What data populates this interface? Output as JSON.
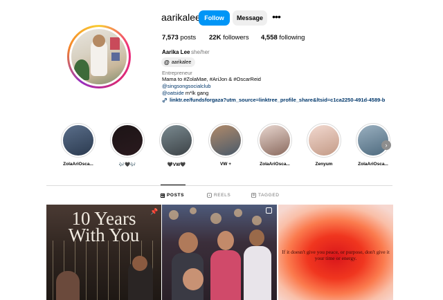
{
  "profile": {
    "username": "aarikalee",
    "follow_label": "Follow",
    "message_label": "Message",
    "more_label": "•••",
    "stats": {
      "posts_count": "7,573",
      "posts_label": "posts",
      "followers_count": "22K",
      "followers_label": "followers",
      "following_count": "4,558",
      "following_label": "following"
    },
    "name": "Aarika Lee",
    "pronouns": "she/her",
    "threads_handle": "aarikalee",
    "category": "Entrepreneur",
    "bio": {
      "line1": "Mama to #ZolaMae, #AriJon & #OscarReid",
      "line2": "@singsongsocialclub",
      "line3_mention": "@oatside",
      "line3_rest": " m*lk gang",
      "link": "linktr.ee/fundsforgaza?utm_source=linktree_profile_share&ltsid=c1ca2250-491d-4589-b"
    }
  },
  "highlights": [
    {
      "label": "ZolaAriOsca...",
      "colors": [
        "#5a6e8a",
        "#2b3a4f"
      ]
    },
    {
      "label": "🎶🖤🎶",
      "colors": [
        "#1c1416",
        "#2a1a1e"
      ]
    },
    {
      "label": "🖤VW🖤",
      "colors": [
        "#7a8a90",
        "#3c4246"
      ]
    },
    {
      "label": "VW +",
      "colors": [
        "#b08a6a",
        "#4a5a6a"
      ]
    },
    {
      "label": "ZolaAriOsca...",
      "colors": [
        "#e8d6cf",
        "#8a6a5e"
      ]
    },
    {
      "label": "Zenyum",
      "colors": [
        "#f2d9d0",
        "#c39a86"
      ]
    },
    {
      "label": "ZolaAriOsca...",
      "colors": [
        "#9ab0c0",
        "#4e6a7e"
      ]
    }
  ],
  "tabs": {
    "posts": "POSTS",
    "reels": "REELS",
    "tagged": "TAGGED"
  },
  "posts": [
    {
      "title_line1": "10 Years",
      "title_line2": "With You"
    },
    {},
    {
      "text": "If it doesn't give you peace, or purpose, don't give it your time or energy."
    }
  ],
  "icons": {
    "more": "more-horizontal-icon",
    "threads": "threads-icon",
    "link": "link-icon",
    "next": "chevron-right-icon",
    "posts_tab": "grid-icon",
    "reels_tab": "reels-icon",
    "tagged_tab": "tag-icon",
    "pinned": "pin-icon",
    "carousel": "carousel-icon"
  },
  "colors": {
    "accent": "#0095f6",
    "link": "#00376b",
    "secondary_text": "#737373"
  }
}
